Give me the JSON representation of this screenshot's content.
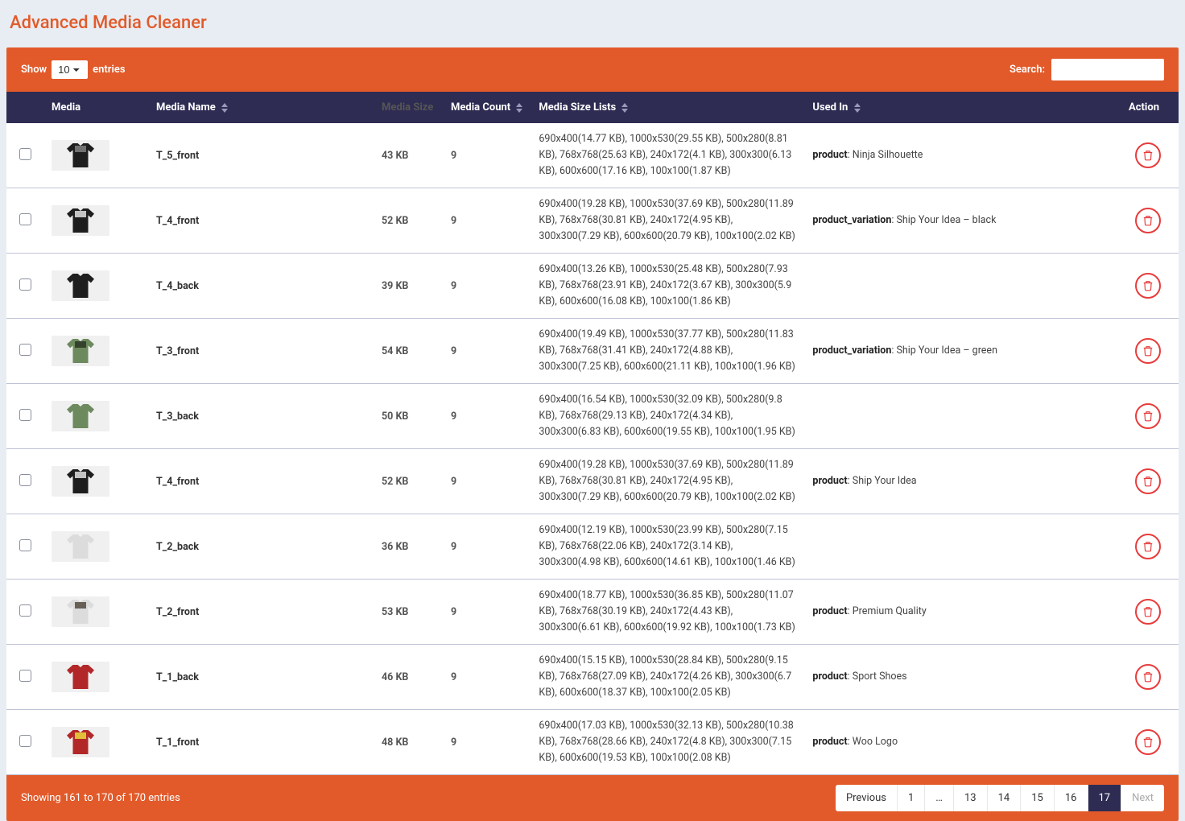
{
  "page_title": "Advanced Media Cleaner",
  "toolbar": {
    "show_label": "Show",
    "entries_label": "entries",
    "entries_options": [
      "10"
    ],
    "entries_selected": "10",
    "search_label": "Search:",
    "search_value": ""
  },
  "columns": {
    "media": "Media",
    "name": "Media Name",
    "size": "Media Size",
    "count": "Media Count",
    "sizelist": "Media Size Lists",
    "usedin": "Used In",
    "action": "Action"
  },
  "rows": [
    {
      "shirt_color": "#1e1e1e",
      "deco_color": "#7a7a7a",
      "name": "T_5_front",
      "size": "43 KB",
      "count": "9",
      "sizelist": "690x400(14.77 KB), 1000x530(29.55 KB), 500x280(8.81 KB), 768x768(25.63 KB), 240x172(4.1 KB), 300x300(6.13 KB), 600x600(17.16 KB), 100x100(1.87 KB)",
      "usedin_type": "product",
      "usedin_value": ": Ninja Silhouette"
    },
    {
      "shirt_color": "#1e1e1e",
      "deco_color": "#d6d6d6",
      "name": "T_4_front",
      "size": "52 KB",
      "count": "9",
      "sizelist": "690x400(19.28 KB), 1000x530(37.69 KB), 500x280(11.89 KB), 768x768(30.81 KB), 240x172(4.95 KB), 300x300(7.29 KB), 600x600(20.79 KB), 100x100(2.02 KB)",
      "usedin_type": "product_variation",
      "usedin_value": ": Ship Your Idea – black"
    },
    {
      "shirt_color": "#1e1e1e",
      "deco_color": "",
      "name": "T_4_back",
      "size": "39 KB",
      "count": "9",
      "sizelist": "690x400(13.26 KB), 1000x530(25.48 KB), 500x280(7.93 KB), 768x768(23.91 KB), 240x172(3.67 KB), 300x300(5.9 KB), 600x600(16.08 KB), 100x100(1.86 KB)",
      "usedin_type": "",
      "usedin_value": ""
    },
    {
      "shirt_color": "#6d8a5e",
      "deco_color": "#2e3a28",
      "name": "T_3_front",
      "size": "54 KB",
      "count": "9",
      "sizelist": "690x400(19.49 KB), 1000x530(37.77 KB), 500x280(11.83 KB), 768x768(31.41 KB), 240x172(4.88 KB), 300x300(7.25 KB), 600x600(21.11 KB), 100x100(1.96 KB)",
      "usedin_type": "product_variation",
      "usedin_value": ": Ship Your Idea – green"
    },
    {
      "shirt_color": "#6d8a5e",
      "deco_color": "",
      "name": "T_3_back",
      "size": "50 KB",
      "count": "9",
      "sizelist": "690x400(16.54 KB), 1000x530(32.09 KB), 500x280(9.8 KB), 768x768(29.13 KB), 240x172(4.34 KB), 300x300(6.83 KB), 600x600(19.55 KB), 100x100(1.95 KB)",
      "usedin_type": "",
      "usedin_value": ""
    },
    {
      "shirt_color": "#1e1e1e",
      "deco_color": "#d6d6d6",
      "name": "T_4_front",
      "size": "52 KB",
      "count": "9",
      "sizelist": "690x400(19.28 KB), 1000x530(37.69 KB), 500x280(11.89 KB), 768x768(30.81 KB), 240x172(4.95 KB), 300x300(7.29 KB), 600x600(20.79 KB), 100x100(2.02 KB)",
      "usedin_type": "product",
      "usedin_value": ": Ship Your Idea"
    },
    {
      "shirt_color": "#dcdcdc",
      "deco_color": "",
      "name": "T_2_back",
      "size": "36 KB",
      "count": "9",
      "sizelist": "690x400(12.19 KB), 1000x530(23.99 KB), 500x280(7.15 KB), 768x768(22.06 KB), 240x172(3.14 KB), 300x300(4.98 KB), 600x600(14.61 KB), 100x100(1.46 KB)",
      "usedin_type": "",
      "usedin_value": ""
    },
    {
      "shirt_color": "#dcdcdc",
      "deco_color": "#5a5248",
      "name": "T_2_front",
      "size": "53 KB",
      "count": "9",
      "sizelist": "690x400(18.77 KB), 1000x530(36.85 KB), 500x280(11.07 KB), 768x768(30.19 KB), 240x172(4.43 KB), 300x300(6.61 KB), 600x600(19.92 KB), 100x100(1.73 KB)",
      "usedin_type": "product",
      "usedin_value": ": Premium Quality"
    },
    {
      "shirt_color": "#b22828",
      "deco_color": "",
      "name": "T_1_back",
      "size": "46 KB",
      "count": "9",
      "sizelist": "690x400(15.15 KB), 1000x530(28.84 KB), 500x280(9.15 KB), 768x768(27.09 KB), 240x172(4.26 KB), 300x300(6.7 KB), 600x600(18.37 KB), 100x100(2.05 KB)",
      "usedin_type": "product",
      "usedin_value": ": Sport Shoes"
    },
    {
      "shirt_color": "#b22828",
      "deco_color": "#e7cf3a",
      "name": "T_1_front",
      "size": "48 KB",
      "count": "9",
      "sizelist": "690x400(17.03 KB), 1000x530(32.13 KB), 500x280(10.38 KB), 768x768(28.66 KB), 240x172(4.8 KB), 300x300(7.15 KB), 600x600(19.53 KB), 100x100(2.08 KB)",
      "usedin_type": "product",
      "usedin_value": ": Woo Logo"
    }
  ],
  "footer": {
    "info": "Showing 161 to 170 of 170 entries",
    "pages": [
      "Previous",
      "1",
      "…",
      "13",
      "14",
      "15",
      "16",
      "17",
      "Next"
    ],
    "active_page": "17",
    "disabled_pages": [
      "Next"
    ]
  }
}
